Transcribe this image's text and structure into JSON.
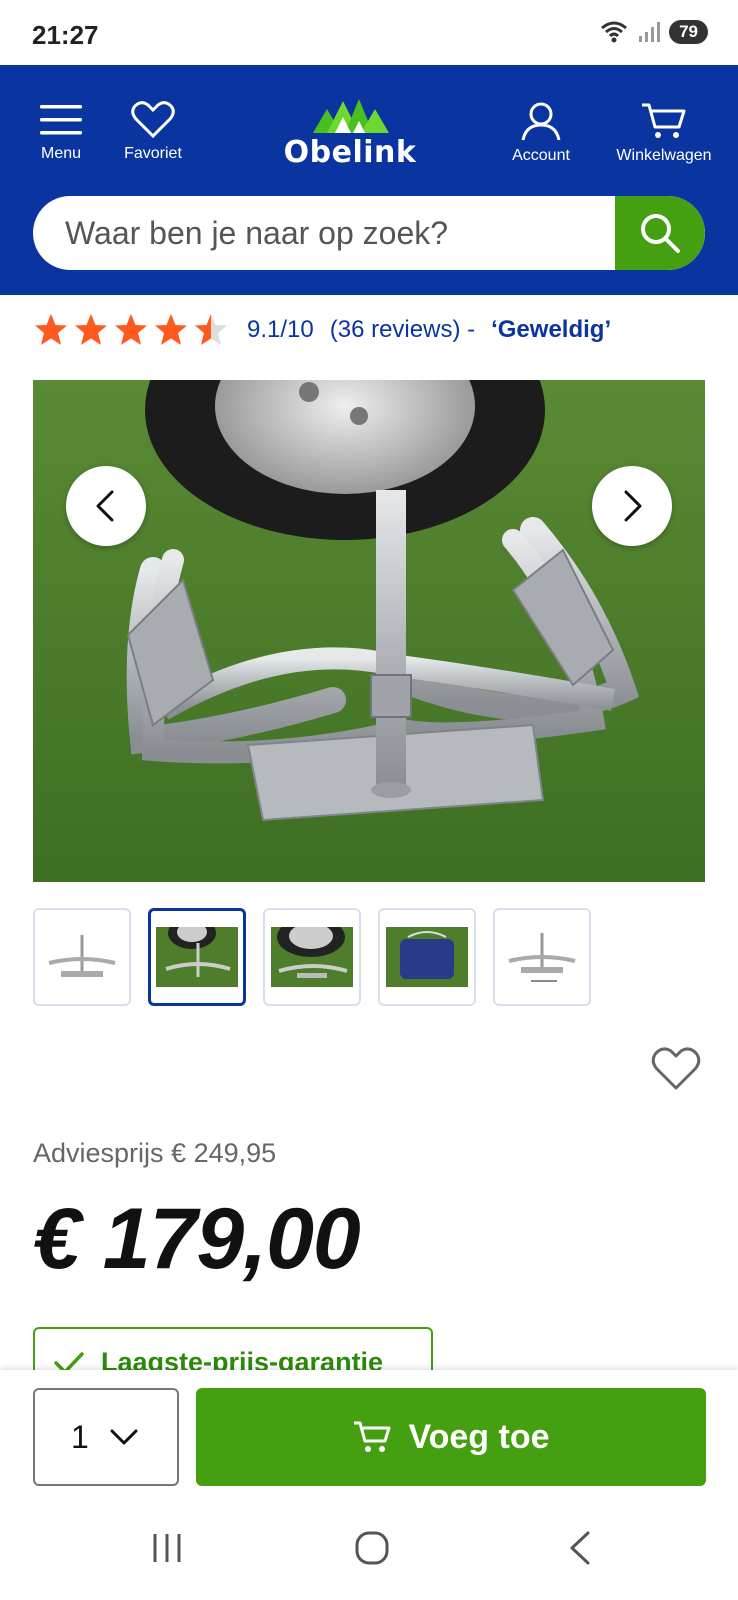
{
  "status": {
    "time": "21:27",
    "battery": "79"
  },
  "header": {
    "menu_label": "Menu",
    "favorites_label": "Favoriet",
    "logo_text": "Obelink",
    "account_label": "Account",
    "cart_label": "Winkelwagen"
  },
  "search": {
    "placeholder": "Waar ben je naar op zoek?"
  },
  "rating": {
    "stars": 4.5,
    "score": "9.1/10",
    "reviews": "(36 reviews) -",
    "label": "‘Geweldig’"
  },
  "gallery": {
    "thumbnail_count": 5,
    "active_thumbnail": 2
  },
  "pricing": {
    "advice_price": "Adviesprijs € 249,95",
    "price": "€ 179,00"
  },
  "guarantee": {
    "label": "Laagste-prijs-garantie"
  },
  "buybar": {
    "quantity": "1",
    "add_label": "Voeg toe"
  },
  "colors": {
    "brand_blue": "#0a35a0",
    "brand_green": "#44a010",
    "star_orange": "#ff5a1e"
  }
}
